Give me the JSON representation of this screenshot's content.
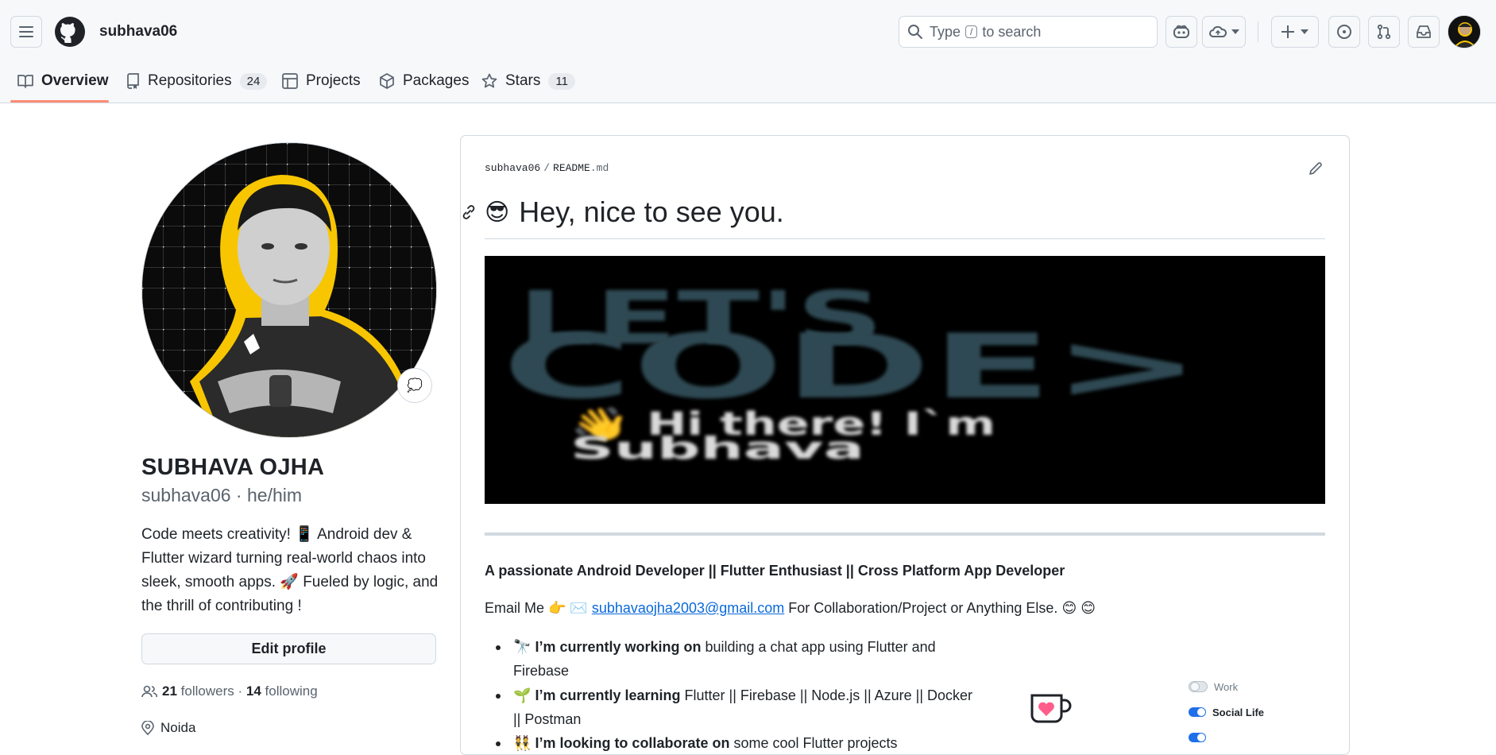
{
  "header": {
    "username": "subhava06",
    "search": {
      "before": "Type",
      "key": "/",
      "after": "to search"
    }
  },
  "tabs": [
    {
      "label": "Overview"
    },
    {
      "label": "Repositories",
      "count": "24"
    },
    {
      "label": "Projects"
    },
    {
      "label": "Packages"
    },
    {
      "label": "Stars",
      "count": "11"
    }
  ],
  "profile": {
    "full_name": "SUBHAVA OJHA",
    "login": "subhava06",
    "pronouns": "he/him",
    "status_emoji": "💭",
    "bio": "Code meets creativity! 📱 Android dev & Flutter wizard turning real-world chaos into sleek, smooth apps. 🚀 Fueled by logic, and the thrill of contributing !",
    "edit_label": "Edit profile",
    "followers": "21",
    "followers_label": "followers",
    "following": "14",
    "following_label": "following",
    "location": "Noida"
  },
  "readme": {
    "path_user": "subhava06",
    "path_file": "README",
    "path_ext": ".md",
    "heading_emoji": "😎",
    "heading": "Hey, nice to see you.",
    "banner": {
      "line1": "LET'S",
      "line2": "CODE>",
      "line3": "👋 Hi there! I`m",
      "line4": "Subhava"
    },
    "tagline": "A passionate Android Developer || Flutter Enthusiast || Cross Platform App Developer",
    "email_prefix": "Email Me 👉 ✉️ ",
    "email": "subhavaojha2003@gmail.com",
    "email_suffix": " For Collaboration/Project or Anything Else. 😊 😊",
    "items": [
      {
        "emoji": "🔭",
        "bold": "I’m currently working on",
        "text": "building a chat app using Flutter and Firebase"
      },
      {
        "emoji": "🌱",
        "bold": "I’m currently learning",
        "text": "Flutter || Firebase || Node.js || Azure || Docker || Postman"
      },
      {
        "emoji": "👯",
        "bold": "I’m looking to collaborate on",
        "text": "some cool Flutter projects"
      }
    ],
    "toggles": [
      {
        "label": "Work",
        "on": false
      },
      {
        "label": "Social Life",
        "on": true
      }
    ]
  },
  "colors": {
    "accent_tab": "#fd8c73",
    "link": "#0969da",
    "banner_text": "#2e4a52",
    "toggle_on": "#1f6feb"
  }
}
